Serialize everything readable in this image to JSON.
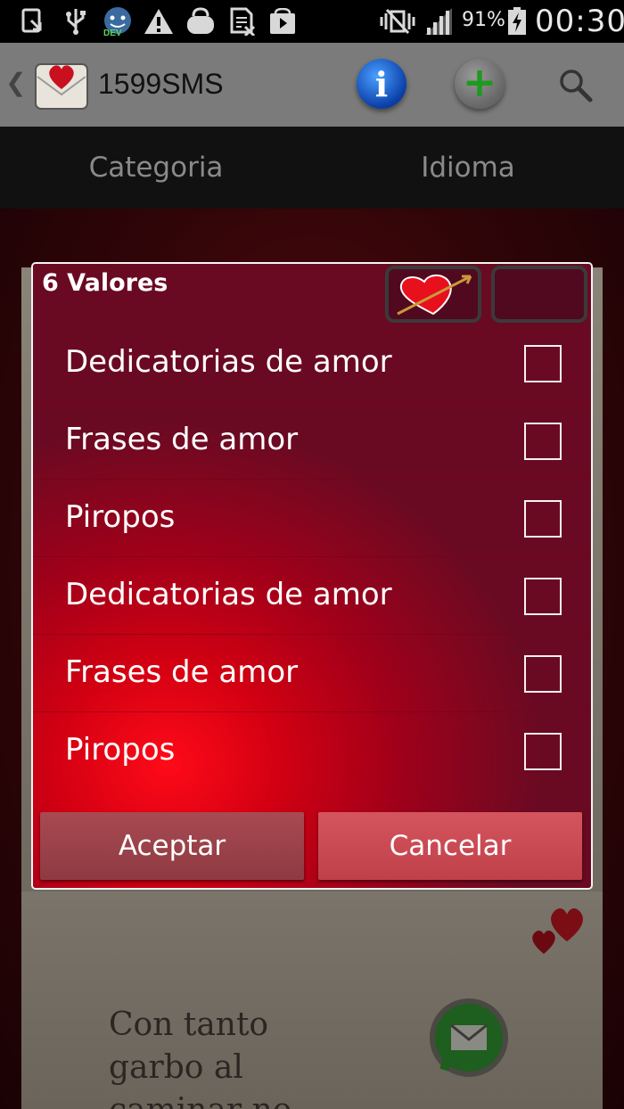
{
  "status_bar": {
    "battery_percent": "91%",
    "time": "00:30",
    "icons": [
      "download-icon",
      "usb-icon",
      "dev-icon",
      "warning-icon",
      "bag-icon",
      "sim-icon",
      "play-store-icon",
      "mute-icon",
      "signal-icon",
      "battery-charging-icon"
    ]
  },
  "action_bar": {
    "title": "1599SMS",
    "icons": [
      "back-chevron-icon",
      "app-logo-icon",
      "info-icon",
      "add-icon",
      "search-icon"
    ]
  },
  "tabs": [
    {
      "label": "Categoria"
    },
    {
      "label": "Idioma"
    }
  ],
  "dialog": {
    "title": "6 Valores",
    "items": [
      {
        "label": "Dedicatorias de amor",
        "checked": false
      },
      {
        "label": "Frases de amor",
        "checked": false
      },
      {
        "label": "Piropos",
        "checked": false
      },
      {
        "label": "Dedicatorias de amor",
        "checked": false
      },
      {
        "label": "Frases de amor",
        "checked": false
      },
      {
        "label": "Piropos",
        "checked": false
      }
    ],
    "accept_label": "Aceptar",
    "cancel_label": "Cancelar"
  },
  "background_card": {
    "text": "Con tanto\ngarbo al\ncaminar no"
  },
  "colors": {
    "dialog_accent": "#d20012",
    "action_bar": "#7b7b7b",
    "tab_bar": "#111111",
    "tab_text": "#8a8a8a"
  }
}
